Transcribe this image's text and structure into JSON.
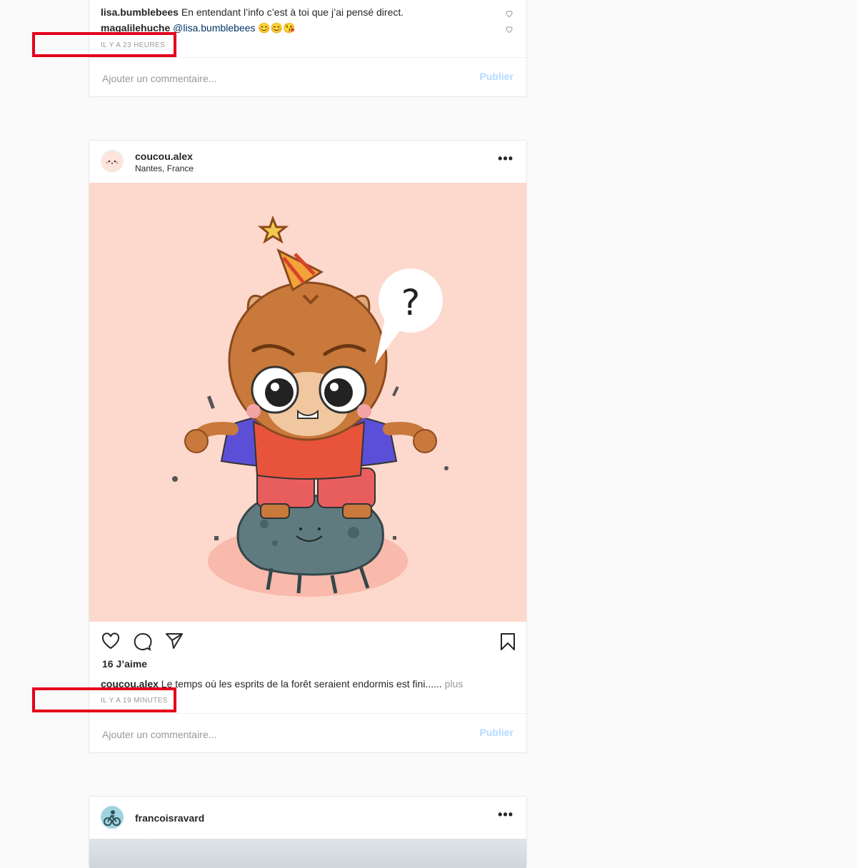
{
  "post1": {
    "comments": [
      {
        "user": "lisa.bumblebees",
        "text": " En entendant l’info c’est à toi que j’ai pensé direct."
      },
      {
        "user": "magalilehuche",
        "mention": " @lisa.bumblebees",
        "text": " 😊😊😘"
      }
    ],
    "timestamp": "IL Y A 23 HEURES",
    "add_comment_placeholder": "Ajouter un commentaire...",
    "publish_label": "Publier"
  },
  "post2": {
    "username": "coucou.alex",
    "location": "Nantes, France",
    "more_label": "•••",
    "likes": "16 J’aime",
    "caption_user": "coucou.alex",
    "caption_text": " Le temps où les esprits de la forêt seraient endormis est fini......",
    "more_text": " plus",
    "bubble_text": "?",
    "timestamp": "IL Y A 19 MINUTES",
    "add_comment_placeholder": "Ajouter un commentaire...",
    "publish_label": "Publier"
  },
  "post3": {
    "username": "francoisravard",
    "more_label": "•••"
  },
  "colors": {
    "illustration_bg": "#fdd8cc",
    "highlight": "#e3001b",
    "publish": "#b3dbff"
  },
  "icons": [
    "heart-icon",
    "comment-icon",
    "share-icon",
    "bookmark-icon",
    "more-icon"
  ]
}
